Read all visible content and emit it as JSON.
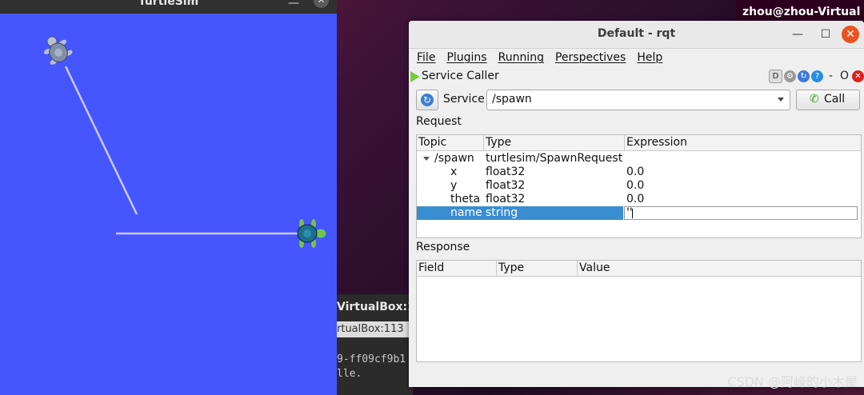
{
  "desktop": {
    "user_label": "zhou@zhou-Virtual"
  },
  "turtlesim": {
    "title": "TurtleSim",
    "minimize_label": "—",
    "close_label": "✕"
  },
  "terminal": {
    "tab1": "VirtualBox:1",
    "tab2": "rtualBox:113",
    "line1": "9-ff09cf9b1",
    "line2": "lle."
  },
  "rqt": {
    "title": "Default - rqt",
    "window_buttons": {
      "minimize": "—",
      "maximize": "☐",
      "close": "✕"
    },
    "menu": [
      "File",
      "Plugins",
      "Running",
      "Perspectives",
      "Help"
    ],
    "plugin_title": "Service Caller",
    "plugin_icons": {
      "d": "D",
      "dash": "-",
      "o": "O"
    },
    "service_label": "Service",
    "service_value": "/spawn",
    "call_label": "Call",
    "request_label": "Request",
    "request_columns": [
      "Topic",
      "Type",
      "Expression"
    ],
    "request_rows": [
      {
        "topic": "/spawn",
        "type": "turtlesim/SpawnRequest",
        "expr": ""
      },
      {
        "topic": "x",
        "type": "float32",
        "expr": "0.0"
      },
      {
        "topic": "y",
        "type": "float32",
        "expr": "0.0"
      },
      {
        "topic": "theta",
        "type": "float32",
        "expr": "0.0"
      },
      {
        "topic": "name",
        "type": "string",
        "expr": "''"
      }
    ],
    "response_label": "Response",
    "response_columns": [
      "Field",
      "Type",
      "Value"
    ]
  },
  "watermark": "CSDN @阿峰的小木屋",
  "colors": {
    "turtlesim_bg": "#4556ff",
    "selection": "#3a8dd0",
    "close_orange": "#e95420"
  }
}
